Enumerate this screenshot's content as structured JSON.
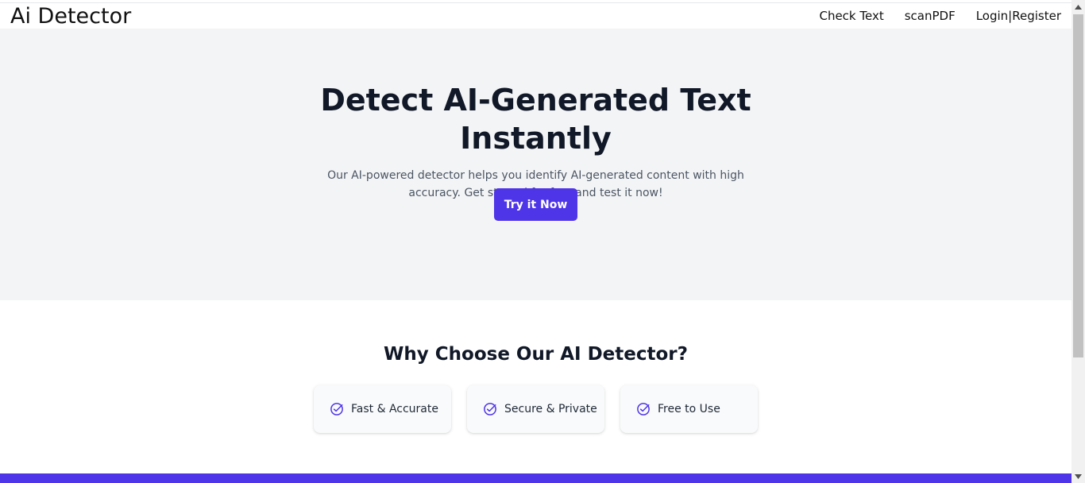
{
  "navbar": {
    "brand": "Ai Detector",
    "links": {
      "check_text": "Check Text",
      "scan_pdf": "scanPDF",
      "login": "Login",
      "separator": "|",
      "register": "Register"
    }
  },
  "hero": {
    "title": "Detect AI-Generated Text Instantly",
    "subtitle": "Our AI-powered detector helps you identify AI-generated content with high accuracy. Get started for free and test it now!",
    "cta_label": "Try it Now"
  },
  "features": {
    "title": "Why Choose Our AI Detector?",
    "items": [
      {
        "label": "Fast & Accurate",
        "icon": "check-circle-icon"
      },
      {
        "label": "Secure & Private",
        "icon": "check-circle-icon"
      },
      {
        "label": "Free to Use",
        "icon": "check-circle-icon"
      }
    ]
  },
  "colors": {
    "accent": "#4f35e8",
    "hero_bg": "#f3f4f6",
    "heading": "#111827",
    "body_text": "#4b5563"
  }
}
